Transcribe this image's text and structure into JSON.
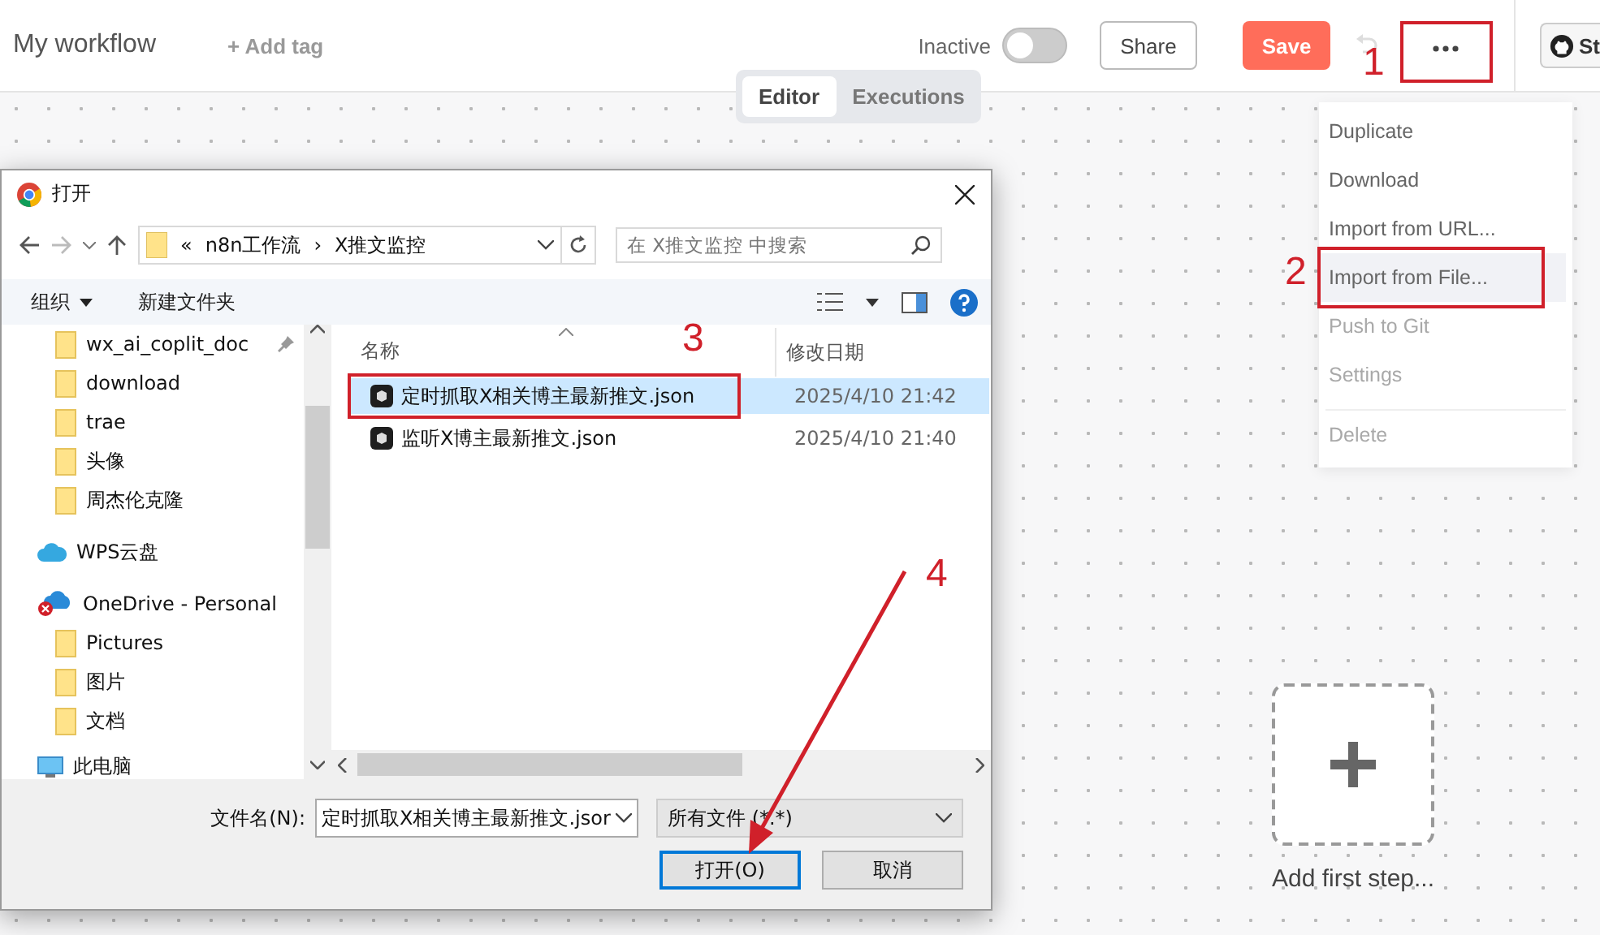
{
  "header": {
    "title": "My workflow",
    "add_tag": "+ Add tag",
    "active_label": "Inactive",
    "active": false,
    "share": "Share",
    "save": "Save",
    "github": "St"
  },
  "view_tabs": [
    {
      "label": "Editor",
      "selected": true
    },
    {
      "label": "Executions",
      "selected": false
    }
  ],
  "menu": [
    {
      "label": "Duplicate",
      "disabled": false,
      "selected": false
    },
    {
      "label": "Download",
      "disabled": false,
      "selected": false
    },
    {
      "label": "Import from URL...",
      "disabled": false,
      "selected": false
    },
    {
      "label": "Import from File...",
      "disabled": false,
      "selected": true
    },
    {
      "label": "Push to Git",
      "disabled": true,
      "selected": false
    },
    {
      "label": "Settings",
      "disabled": true,
      "selected": false
    },
    {
      "label": "Delete",
      "disabled": true,
      "selected": false,
      "divider_before": true
    }
  ],
  "canvas": {
    "add_first_step": "Add first step..."
  },
  "dialog": {
    "title": "打开",
    "path": [
      "«",
      "n8n工作流",
      "X推文监控"
    ],
    "path_separator": "›",
    "search": {
      "placeholder": "在 X推文监控 中搜索"
    },
    "organize": "组织",
    "new_folder": "新建文件夹",
    "nav": [
      {
        "label": "wx_ai_coplit_doc",
        "kind": "folder",
        "pinned": true
      },
      {
        "label": "download",
        "kind": "folder",
        "pinned": false
      },
      {
        "label": "trae",
        "kind": "folder",
        "pinned": false
      },
      {
        "label": "头像",
        "kind": "folder",
        "pinned": false
      },
      {
        "label": "周杰伦克隆",
        "kind": "folder",
        "pinned": false
      },
      {
        "label": "WPS云盘",
        "kind": "cloud",
        "pinned": false
      },
      {
        "label": "OneDrive - Personal",
        "kind": "onedrive",
        "pinned": false,
        "children": [
          {
            "label": "Pictures",
            "kind": "folder",
            "pinned": false
          },
          {
            "label": "图片",
            "kind": "folder",
            "pinned": false
          },
          {
            "label": "文档",
            "kind": "folder",
            "pinned": false
          }
        ]
      },
      {
        "label": "此电脑",
        "kind": "pc",
        "pinned": false
      }
    ],
    "columns": [
      "名称",
      "修改日期"
    ],
    "files": [
      {
        "name": "定时抓取X相关博主最新推文.json",
        "modified": "2025/4/10 21:42",
        "selected": true
      },
      {
        "name": "监听X博主最新推文.json",
        "modified": "2025/4/10 21:40",
        "selected": false
      }
    ],
    "filename_label": "文件名(N):",
    "filename": "定时抓取X相关博主最新推文.jsor",
    "filetype": "所有文件 (*.*)",
    "open": "打开(O)",
    "cancel": "取消"
  },
  "annotations": [
    {
      "label": "1"
    },
    {
      "label": "2"
    },
    {
      "label": "3"
    },
    {
      "label": "4"
    }
  ]
}
